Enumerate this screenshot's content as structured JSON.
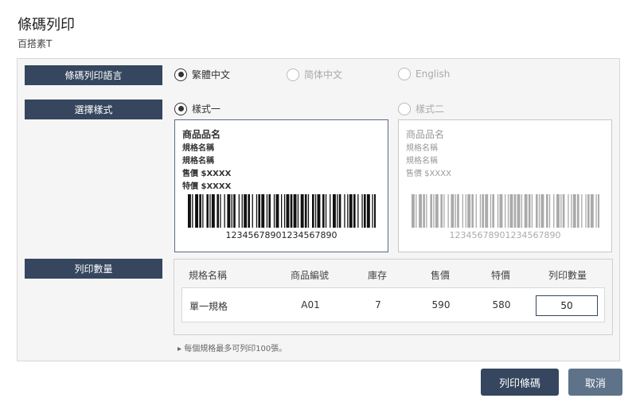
{
  "dialog": {
    "title": "條碼列印",
    "subtitle": "百搭素T"
  },
  "language": {
    "label": "條碼列印語言",
    "options": [
      "繁體中文",
      "简体中文",
      "English"
    ],
    "selected": "繁體中文"
  },
  "style": {
    "label": "選擇樣式",
    "options": [
      "樣式一",
      "樣式二"
    ],
    "selected": "樣式一",
    "preview1": {
      "name": "商品品名",
      "spec1": "規格名稱",
      "spec2": "規格名稱",
      "price": "售價 $XXXX",
      "special": "特價 $XXXX",
      "barcode": "12345678901234567890"
    },
    "preview2": {
      "name": "商品品名",
      "spec1": "規格名稱",
      "spec2": "規格名稱",
      "price": "售價 $XXXX",
      "barcode": "12345678901234567890"
    }
  },
  "quantity": {
    "label": "列印數量",
    "headers": [
      "規格名稱",
      "商品編號",
      "庫存",
      "售價",
      "特價",
      "列印數量"
    ],
    "row": {
      "spec": "單一規格",
      "code": "A01",
      "stock": "7",
      "price": "590",
      "special": "580",
      "qty": "50"
    },
    "note": "▸ 每個規格最多可列印100張。"
  },
  "buttons": {
    "print": "列印條碼",
    "cancel": "取消"
  },
  "colors": {
    "accent": "#35465e",
    "cancel": "#5e7389"
  }
}
